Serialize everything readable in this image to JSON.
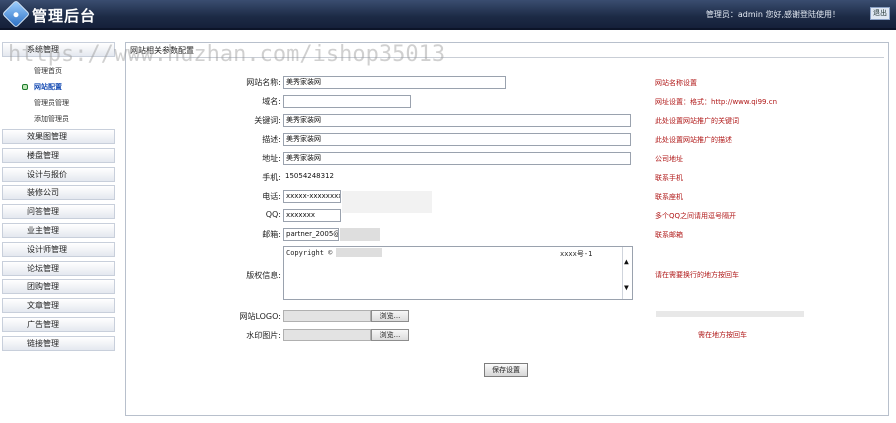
{
  "header": {
    "title": "管理后台",
    "user_info": "管理员：admin 您好,感谢登陆使用！",
    "logout_label": "退出"
  },
  "watermark": "https://www.huzhan.com/ishop35013",
  "sidebar": {
    "items": [
      {
        "label": "系统管理"
      },
      {
        "label": "效果图管理"
      },
      {
        "label": "楼盘管理"
      },
      {
        "label": "设计与报价"
      },
      {
        "label": "装修公司"
      },
      {
        "label": "问答管理"
      },
      {
        "label": "业主管理"
      },
      {
        "label": "设计师管理"
      },
      {
        "label": "论坛管理"
      },
      {
        "label": "团购管理"
      },
      {
        "label": "文章管理"
      },
      {
        "label": "广告管理"
      },
      {
        "label": "链接管理"
      }
    ],
    "sub_items": [
      {
        "label": "管理首页",
        "active": false
      },
      {
        "label": "网站配置",
        "active": true
      },
      {
        "label": "管理员管理",
        "active": false
      },
      {
        "label": "添加管理员",
        "active": false
      }
    ]
  },
  "panel": {
    "tab_label": "网站相关参数配置",
    "fields": {
      "site_name": {
        "label": "网站名称:",
        "value": "美秀家装网",
        "hint": "网站名称设置"
      },
      "domain": {
        "label": "域名:",
        "value": "",
        "hint": "网址设置：格式：http://www.qi99.cn"
      },
      "keywords": {
        "label": "关键词:",
        "value": "美秀家装网",
        "hint": "此处设置网站推广的关键词"
      },
      "description": {
        "label": "描述:",
        "value": "美秀家装网",
        "hint": "此处设置网站推广的描述"
      },
      "address": {
        "label": "地址:",
        "value": "美秀家装网",
        "hint": "公司地址"
      },
      "mobile": {
        "label": "手机:",
        "value": "15054248312",
        "hint": "联系手机"
      },
      "phone": {
        "label": "电话:",
        "value": "xxxxx-xxxxxxxx",
        "hint": "联系座机"
      },
      "qq": {
        "label": "QQ:",
        "value": "xxxxxxx",
        "hint": "多个QQ之间请用逗号隔开"
      },
      "email": {
        "label": "邮箱:",
        "value": "partner_2005@",
        "hint": "联系邮箱"
      },
      "copyright": {
        "label": "版权信息:",
        "value": "Copyright ©",
        "suffix": "xxxx号-1",
        "hint": "请在需要换行的地方按回车"
      },
      "logo": {
        "label": "网站LOGO:",
        "browse_label": "浏览..."
      },
      "watermark_img": {
        "label": "水印图片:",
        "browse_label": "浏览...",
        "hint": "需在地方按回车"
      }
    },
    "save_label": "保存设置"
  }
}
